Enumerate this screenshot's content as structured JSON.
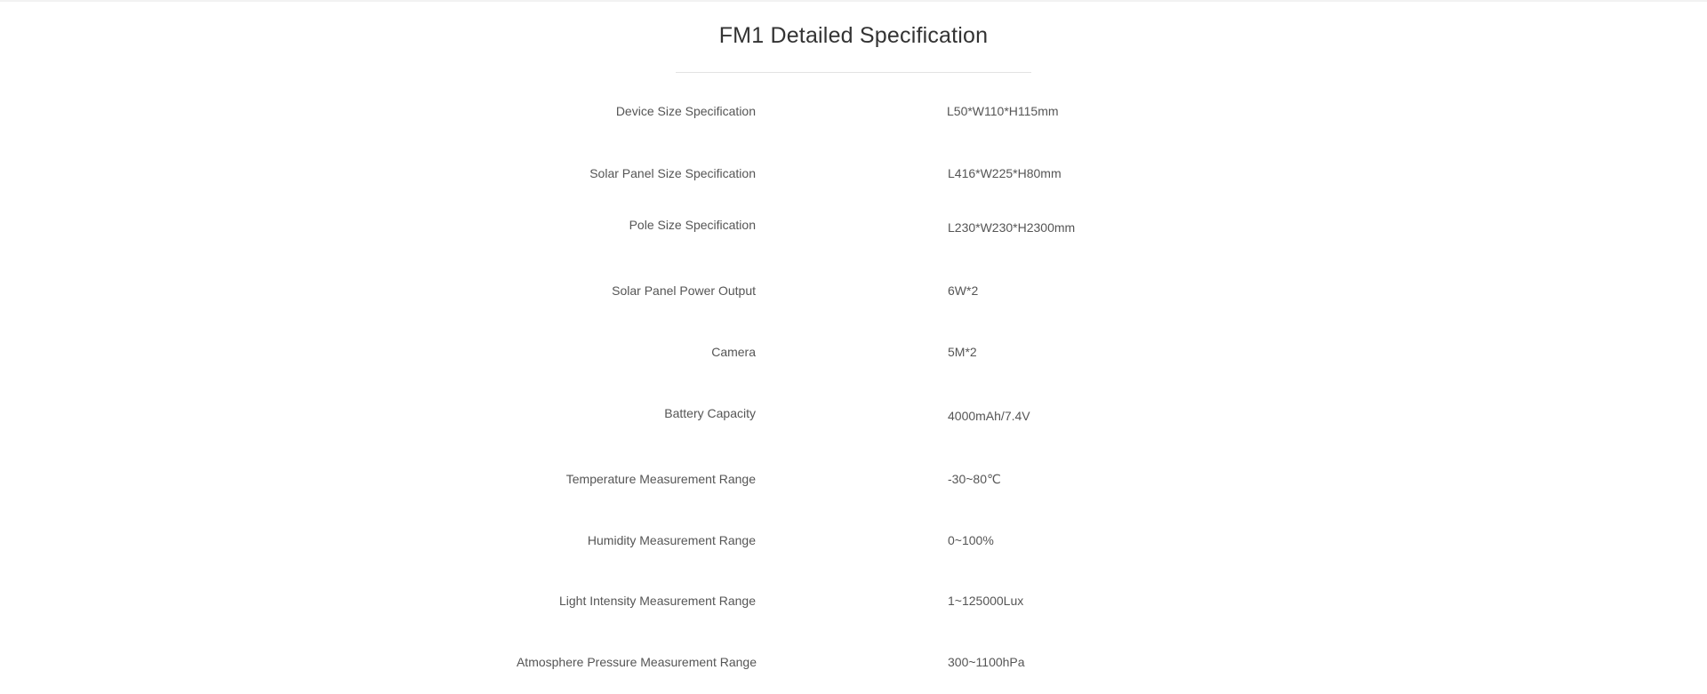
{
  "title": "FM1 Detailed Specification",
  "specs": [
    {
      "label": "Device Size Specification",
      "value": "L50*W110*H115mm"
    },
    {
      "label": "Solar Panel Size Specification",
      "value": "L416*W225*H80mm"
    },
    {
      "label": "Pole Size Specification",
      "value": "L230*W230*H2300mm"
    },
    {
      "label": "Solar Panel Power Output",
      "value": "6W*2"
    },
    {
      "label": "Camera",
      "value": "5M*2"
    },
    {
      "label": "Battery Capacity",
      "value": "4000mAh/7.4V"
    },
    {
      "label": "Temperature Measurement Range",
      "value": "-30~80℃"
    },
    {
      "label": "Humidity Measurement Range",
      "value": "0~100%"
    },
    {
      "label": "Light Intensity Measurement Range",
      "value": "1~125000Lux"
    },
    {
      "label": "Atmosphere Pressure Measurement Range",
      "value": "300~1100hPa"
    }
  ]
}
